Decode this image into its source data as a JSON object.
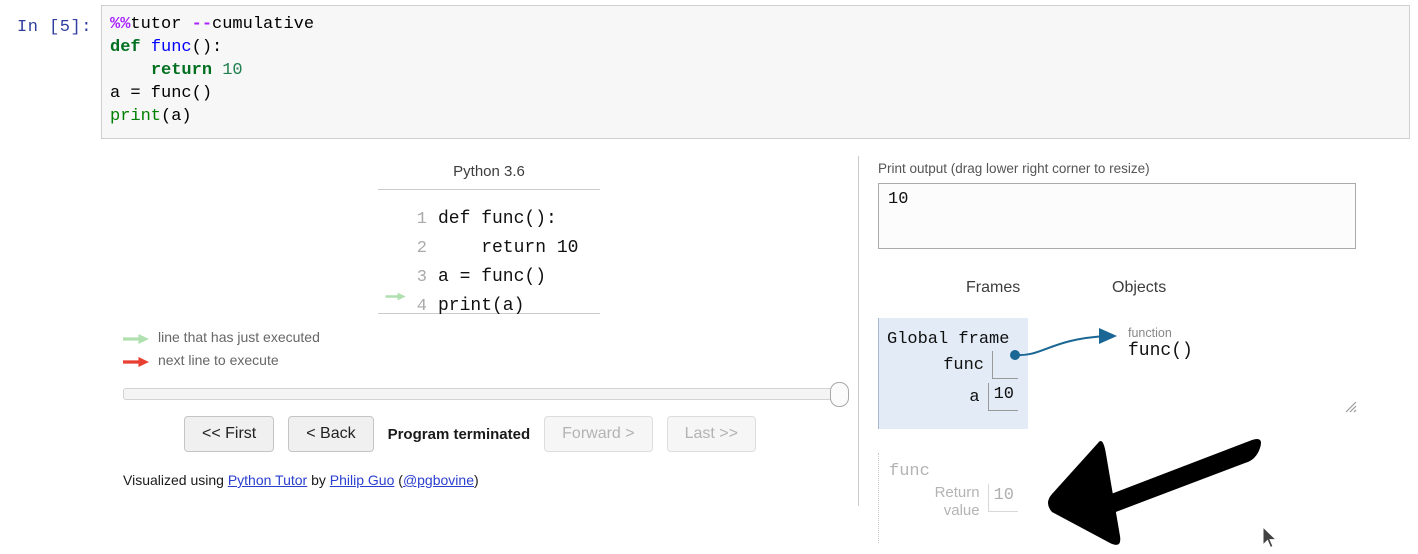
{
  "notebook": {
    "prompt": "In [5]:",
    "code_lines": [
      [
        {
          "t": "%%",
          "c": "magic"
        },
        {
          "t": "tutor ",
          "c": "magicname"
        },
        {
          "t": "--",
          "c": "magic"
        },
        {
          "t": "cumulative",
          "c": "magicname"
        }
      ],
      [
        {
          "t": "def ",
          "c": "kw"
        },
        {
          "t": "func",
          "c": "fname"
        },
        {
          "t": "():",
          "c": "plain"
        }
      ],
      [
        {
          "t": "    ",
          "c": "plain"
        },
        {
          "t": "return ",
          "c": "kw"
        },
        {
          "t": "10",
          "c": "num"
        }
      ],
      [
        {
          "t": "a = func()",
          "c": "plain"
        }
      ],
      [
        {
          "t": "print",
          "c": "builtin"
        },
        {
          "t": "(a)",
          "c": "plain"
        }
      ]
    ]
  },
  "tutor": {
    "language_header": "Python 3.6",
    "code_lines": [
      {
        "number": "1",
        "text": "def func():",
        "arrow": "none"
      },
      {
        "number": "2",
        "text": "    return 10",
        "arrow": "none"
      },
      {
        "number": "3",
        "text": "a = func()",
        "arrow": "none"
      },
      {
        "number": "4",
        "text": "print(a)",
        "arrow": "green"
      }
    ],
    "legend": [
      {
        "arrow_color": "#b0e0b0",
        "label": "line that has just executed"
      },
      {
        "arrow_color": "#e93f33",
        "label": "next line to execute"
      }
    ],
    "controls": {
      "first_label": "<< First",
      "back_label": "< Back",
      "status": "Program terminated",
      "forward_label": "Forward >",
      "last_label": "Last >>"
    },
    "slider": {
      "position_percent": 100
    },
    "credits": {
      "prefix": "Visualized using ",
      "tool_link": "Python Tutor",
      "middle": " by ",
      "author_link": "Philip Guo",
      "open_paren": " (",
      "handle_link": "@pgbovine",
      "close_paren": ")"
    },
    "print_output": {
      "label": "Print output (drag lower right corner to resize)",
      "value": "10"
    },
    "headers": {
      "frames": "Frames",
      "objects": "Objects"
    },
    "global_frame": {
      "title": "Global frame",
      "variables": [
        {
          "name": "func",
          "value": "",
          "is_pointer": true
        },
        {
          "name": "a",
          "value": "10",
          "is_pointer": false
        }
      ]
    },
    "heap_objects": [
      {
        "type_label": "function",
        "value": "func()"
      }
    ],
    "returned_frame": {
      "title": "func",
      "variables": [
        {
          "name": "Return\nvalue",
          "value": "10"
        }
      ]
    }
  },
  "annotation": {
    "arrow_color": "#000000",
    "arrow_direction": "left"
  },
  "colors": {
    "frame_background": "#e2ebf6",
    "pointer_arrow": "#1a6694",
    "link": "#2a3fd0",
    "prompt": "#303f9f",
    "executed_arrow": "#b0e0b0",
    "next_arrow": "#e93f33"
  }
}
